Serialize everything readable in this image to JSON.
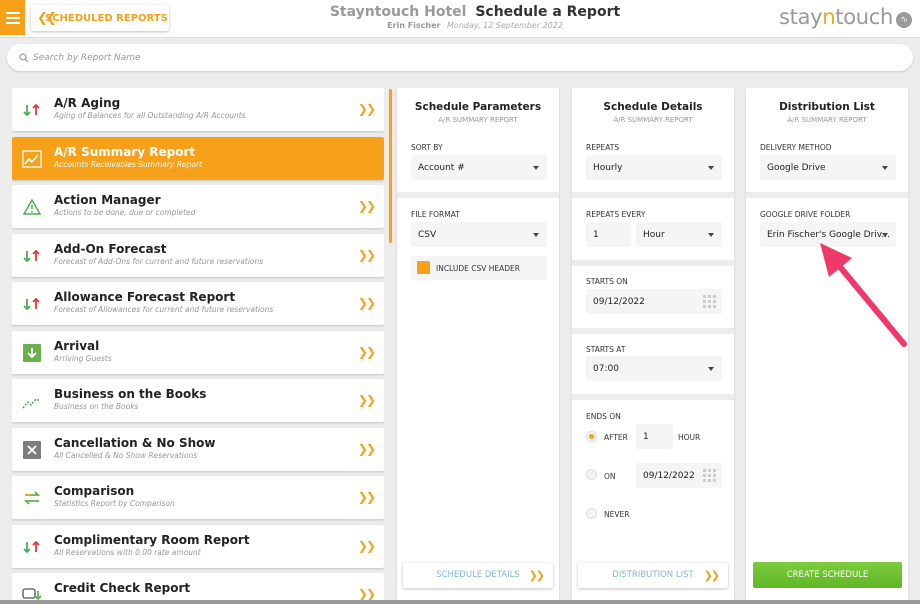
{
  "header": {
    "back_label": "SCHEDULED REPORTS",
    "hotel_name": "Stayntouch Hotel",
    "page_title": "Schedule a Report",
    "user_name": "Erin Fischer",
    "date": "Monday, 12 September 2022",
    "brand_prefix": "stay",
    "brand_accent": "n",
    "brand_suffix": "touch"
  },
  "search": {
    "placeholder": "Search by Report Name"
  },
  "reports": [
    {
      "title": "A/R Aging",
      "subtitle": "Aging of Balances for all Outstanding A/R Accounts",
      "icon": "arrows-up-down-icon",
      "active": false
    },
    {
      "title": "A/R Summary Report",
      "subtitle": "Accounts Receivables Summary Report",
      "icon": "chart-line-icon",
      "active": true
    },
    {
      "title": "Action Manager",
      "subtitle": "Actions to be done, due or completed",
      "icon": "warning-icon",
      "active": false
    },
    {
      "title": "Add-On Forecast",
      "subtitle": "Forecast of Add-Ons for current and future reservations",
      "icon": "arrows-up-down-icon",
      "active": false
    },
    {
      "title": "Allowance Forecast Report",
      "subtitle": "Forecast of Allowances for current and future reservations",
      "icon": "arrows-up-down-icon",
      "active": false
    },
    {
      "title": "Arrival",
      "subtitle": "Arriving Guests",
      "icon": "arrival-icon",
      "active": false
    },
    {
      "title": "Business on the Books",
      "subtitle": "Business on the Books",
      "icon": "trend-icon",
      "active": false
    },
    {
      "title": "Cancellation & No Show",
      "subtitle": "All Cancelled & No Show Reservations",
      "icon": "cancel-icon",
      "active": false
    },
    {
      "title": "Comparison",
      "subtitle": "Statistics Report by Comparison",
      "icon": "compare-icon",
      "active": false
    },
    {
      "title": "Complimentary Room Report",
      "subtitle": "All Reservations with 0.00 rate amount",
      "icon": "arrows-up-down-icon",
      "active": false
    },
    {
      "title": "Credit Check Report",
      "subtitle": "",
      "icon": "credit-card-icon",
      "active": false
    }
  ],
  "params": {
    "title": "Schedule Parameters",
    "subtitle": "A/R SUMMARY REPORT",
    "sort_label": "SORT BY",
    "sort_value": "Account #",
    "format_label": "FILE FORMAT",
    "format_value": "CSV",
    "csv_header_label": "INCLUDE CSV HEADER",
    "csv_header_checked": true,
    "footer_label": "SCHEDULE DETAILS"
  },
  "details": {
    "title": "Schedule Details",
    "subtitle": "A/R SUMMARY REPORT",
    "repeats_label": "REPEATS",
    "repeats_value": "Hourly",
    "every_label": "REPEATS EVERY",
    "every_value": "1",
    "every_unit": "Hour",
    "starts_on_label": "STARTS ON",
    "starts_on_value": "09/12/2022",
    "starts_at_label": "STARTS AT",
    "starts_at_value": "07:00",
    "ends_label": "ENDS ON",
    "after_label": "AFTER",
    "after_value": "1",
    "after_unit": "HOUR",
    "on_label": "ON",
    "on_value": "09/12/2022",
    "never_label": "NEVER",
    "ends_selected": "after",
    "footer_label": "DISTRIBUTION LIST"
  },
  "distribution": {
    "title": "Distribution List",
    "subtitle": "A/R SUMMARY REPORT",
    "method_label": "DELIVERY METHOD",
    "method_value": "Google Drive",
    "folder_label": "GOOGLE DRIVE FOLDER",
    "folder_value": "Erin Fischer's Google Driv...",
    "create_label": "CREATE SCHEDULE"
  },
  "colors": {
    "accent": "#f7a11a",
    "create_green": "#5fb724",
    "annotation_arrow": "#f0386b",
    "link_blue": "#7fb7dd"
  }
}
